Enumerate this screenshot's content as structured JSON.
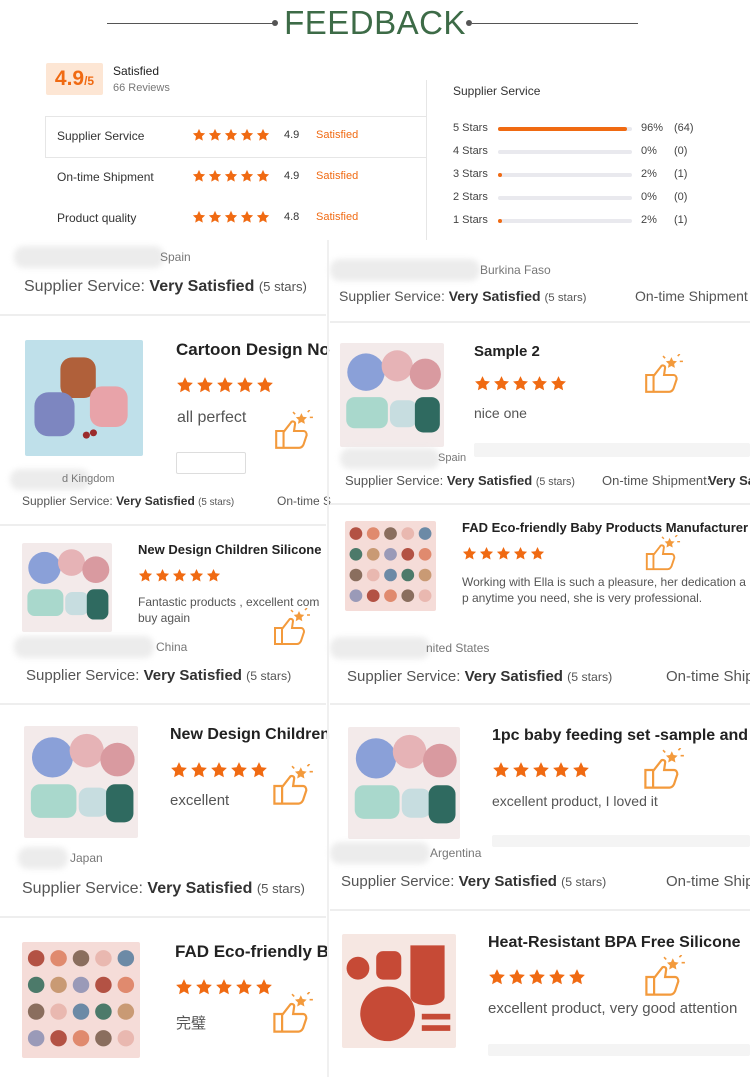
{
  "header": {
    "title": "FEEDBACK"
  },
  "summary": {
    "score": "4.9",
    "score_max": "/5",
    "status": "Satisfied",
    "reviews": "66 Reviews",
    "categories": [
      {
        "label": "Supplier Service",
        "score": "4.9",
        "status": "Satisfied"
      },
      {
        "label": "On-time Shipment",
        "score": "4.9",
        "status": "Satisfied"
      },
      {
        "label": "Product quality",
        "score": "4.8",
        "status": "Satisfied"
      }
    ]
  },
  "distribution": {
    "title": "Supplier Service",
    "rows": [
      {
        "label": "5 Stars",
        "fraction": 0.96,
        "pct": "96%",
        "count": "(64)"
      },
      {
        "label": "4 Stars",
        "fraction": 0.0,
        "pct": "0%",
        "count": "(0)"
      },
      {
        "label": "3 Stars",
        "fraction": 0.02,
        "pct": "2%",
        "count": "(1)"
      },
      {
        "label": "2 Stars",
        "fraction": 0.0,
        "pct": "0%",
        "count": "(0)"
      },
      {
        "label": "1 Stars",
        "fraction": 0.02,
        "pct": "2%",
        "count": "(1)"
      }
    ]
  },
  "meta_text": {
    "service_label": "Supplier Service:",
    "very_satisfied": "Very Satisfied",
    "five_stars": "(5 stars)",
    "ontime_label": "On-time Shipment",
    "ontime_label_colon": "On-time Shipment:",
    "ontime_short": "On-time S",
    "ontime_ship": "On-time Ship",
    "very_sa": "Very Sa"
  },
  "reviews": [
    {
      "country": "Spain",
      "product": "Cartoon Design No",
      "comment": "all perfect"
    },
    {
      "country": "Burkina Faso",
      "product": "Sample 2",
      "comment": "nice one"
    },
    {
      "country": "d Kingdom",
      "product": "New Design Children Silicone",
      "comment": "Fantastic products , excellent com",
      "comment2": "buy again"
    },
    {
      "country": "Spain",
      "product": "FAD Eco-friendly Baby Products Manufacturer",
      "comment": "Working with Ella is such a pleasure, her dedication a",
      "comment2": "p anytime you need, she is very professional."
    },
    {
      "country": "China",
      "product": "New Design Children",
      "comment": "excellent"
    },
    {
      "country": "nited States",
      "product": "1pc baby feeding set -sample and",
      "comment": "excellent product, I loved it"
    },
    {
      "country": "Japan",
      "product": "FAD Eco-friendly B",
      "comment": "完璧"
    },
    {
      "country": "Argentina",
      "product": "Heat-Resistant BPA Free Silicone",
      "comment": "excellent product, very good attention"
    }
  ],
  "icons": {
    "star": "star-icon",
    "thumbs_up": "thumbs-up-icon"
  },
  "colors": {
    "accent": "#f06a12",
    "title_green": "#3d6b47"
  }
}
